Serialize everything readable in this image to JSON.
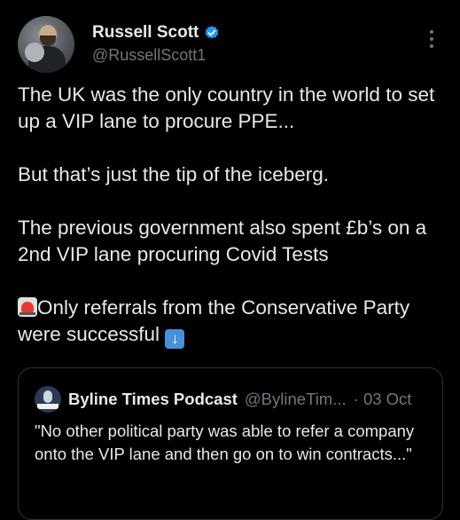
{
  "author": {
    "name": "Russell Scott",
    "handle": "@RussellScott1",
    "verified_color": "#1d9bf0"
  },
  "tweet": {
    "line1": "The UK was the only country in the world to set up a VIP lane to procure PPE...",
    "line2": "But that’s just the tip of the iceberg.",
    "line3": "The previous government also spent £b’s on a 2nd VIP lane procuring Covid Tests",
    "line4": "Only referrals from the Conservative Party were successful",
    "emoji_siren": "siren-icon",
    "emoji_arrow": "down-arrow-icon"
  },
  "quote": {
    "name": "Byline Times Podcast",
    "handle": "@BylineTim...",
    "dot_date": "· 03 Oct",
    "text": "\"No other political party was able to refer a company onto the VIP lane and then go on to win contracts...\""
  },
  "colors": {
    "background": "#000000",
    "text": "#e7e9ea",
    "muted": "#71767b",
    "border": "#2f3336"
  }
}
